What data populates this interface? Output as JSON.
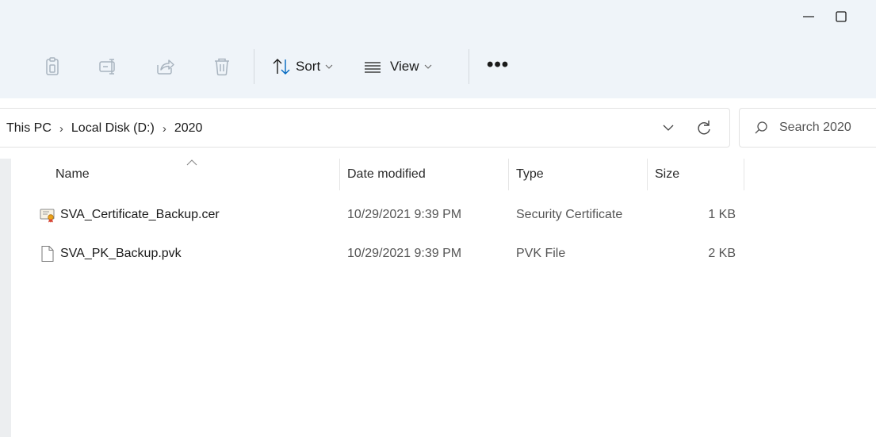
{
  "window": {
    "minimize_icon": "minimize-icon",
    "maximize_icon": "maximize-icon"
  },
  "toolbar": {
    "icons": [
      "copy-icon",
      "rename-icon",
      "share-icon",
      "delete-icon"
    ],
    "sort_label": "Sort",
    "view_label": "View",
    "more_label": "•••"
  },
  "address": {
    "crumbs": [
      "This PC",
      "Local Disk (D:)",
      "2020"
    ],
    "separator": "›"
  },
  "search": {
    "placeholder": "Search 2020"
  },
  "columns": {
    "name": "Name",
    "date": "Date modified",
    "type": "Type",
    "size": "Size"
  },
  "files": [
    {
      "name": "SVA_Certificate_Backup.cer",
      "date": "10/29/2021 9:39 PM",
      "type": "Security Certificate",
      "size": "1 KB",
      "icon": "certificate-file-icon"
    },
    {
      "name": "SVA_PK_Backup.pvk",
      "date": "10/29/2021 9:39 PM",
      "type": "PVK File",
      "size": "2 KB",
      "icon": "generic-file-icon"
    }
  ],
  "colors": {
    "toolbar_bg": "#eff4f9",
    "accent": "#0067c0"
  }
}
